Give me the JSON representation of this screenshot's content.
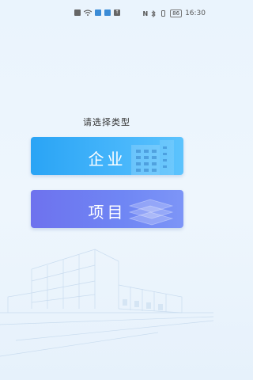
{
  "status_bar": {
    "time": "16:30",
    "battery": "86",
    "nfc": "N"
  },
  "page": {
    "prompt": "请选择类型"
  },
  "options": [
    {
      "label": "企业",
      "icon": "building-icon"
    },
    {
      "label": "项目",
      "icon": "layers-icon"
    }
  ]
}
